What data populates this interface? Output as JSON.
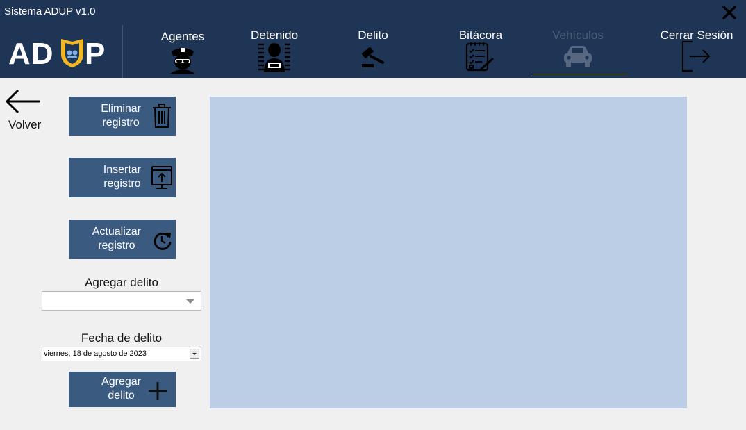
{
  "app": {
    "title": "Sistema ADUP v1.0",
    "logo_text": "ADUP"
  },
  "window": {
    "close_icon": "close-x-icon"
  },
  "nav": {
    "agentes": {
      "label": "Agentes",
      "icon": "police-officer-icon"
    },
    "detenido": {
      "label": "Detenido",
      "icon": "detainee-icon"
    },
    "delito": {
      "label": "Delito",
      "icon": "gavel-icon"
    },
    "bitacora": {
      "label": "Bitácora",
      "icon": "checklist-icon"
    },
    "vehiculos": {
      "label": "Vehículos",
      "icon": "car-icon",
      "state": "disabled"
    },
    "cerrar": {
      "label": "Cerrar Sesión",
      "icon": "logout-icon"
    }
  },
  "back": {
    "label": "Volver",
    "icon": "arrow-left-icon"
  },
  "actions": {
    "eliminar": {
      "line1": "Eliminar",
      "line2": "registro",
      "icon": "trash-icon"
    },
    "insertar": {
      "line1": "Insertar",
      "line2": "registro",
      "icon": "upload-icon"
    },
    "actualizar": {
      "line1": "Actualizar",
      "line2": "registro",
      "icon": "refresh-icon"
    },
    "agregar": {
      "line1": "Agregar",
      "line2": "delito",
      "icon": "plus-icon"
    }
  },
  "form": {
    "delito_label": "Agregar delito",
    "delito_value": "",
    "fecha_label": "Fecha de delito",
    "fecha_value": "viernes, 18  de agosto de 2023"
  },
  "colors": {
    "header": "#1f3555",
    "button": "#3a5a80",
    "grid": "#bccde6",
    "logo_gold": "#f2b824",
    "nav_underline": "#c9b545"
  }
}
